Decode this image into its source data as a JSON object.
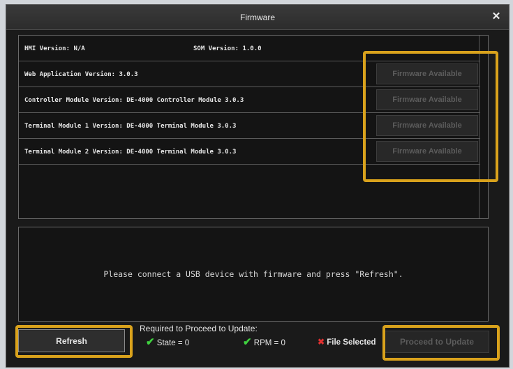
{
  "dialog": {
    "title": "Firmware",
    "close_icon": "✕"
  },
  "versions": {
    "hmi": "HMI Version: N/A",
    "som": "SOM Version: 1.0.0",
    "rows": [
      {
        "label": "Web Application Version: 3.0.3",
        "button": "Firmware Available"
      },
      {
        "label": "Controller Module Version: DE-4000 Controller Module 3.0.3",
        "button": "Firmware Available"
      },
      {
        "label": "Terminal Module 1 Version: DE-4000 Terminal Module 3.0.3",
        "button": "Firmware Available"
      },
      {
        "label": "Terminal Module 2 Version: DE-4000 Terminal Module 3.0.3",
        "button": "Firmware Available"
      }
    ]
  },
  "message": "Please connect a USB device with firmware and press \"Refresh\".",
  "footer": {
    "refresh_label": "Refresh",
    "required_title": "Required to Proceed to Update:",
    "state": {
      "icon": "✔",
      "text": "State = 0"
    },
    "rpm": {
      "icon": "✔",
      "text": "RPM = 0"
    },
    "file": {
      "icon": "✖",
      "text": "File Selected"
    },
    "proceed_label": "Proceed to Update"
  },
  "colors": {
    "highlight": "#d9a21c",
    "ok": "#3fd23f",
    "bad": "#e03030"
  }
}
